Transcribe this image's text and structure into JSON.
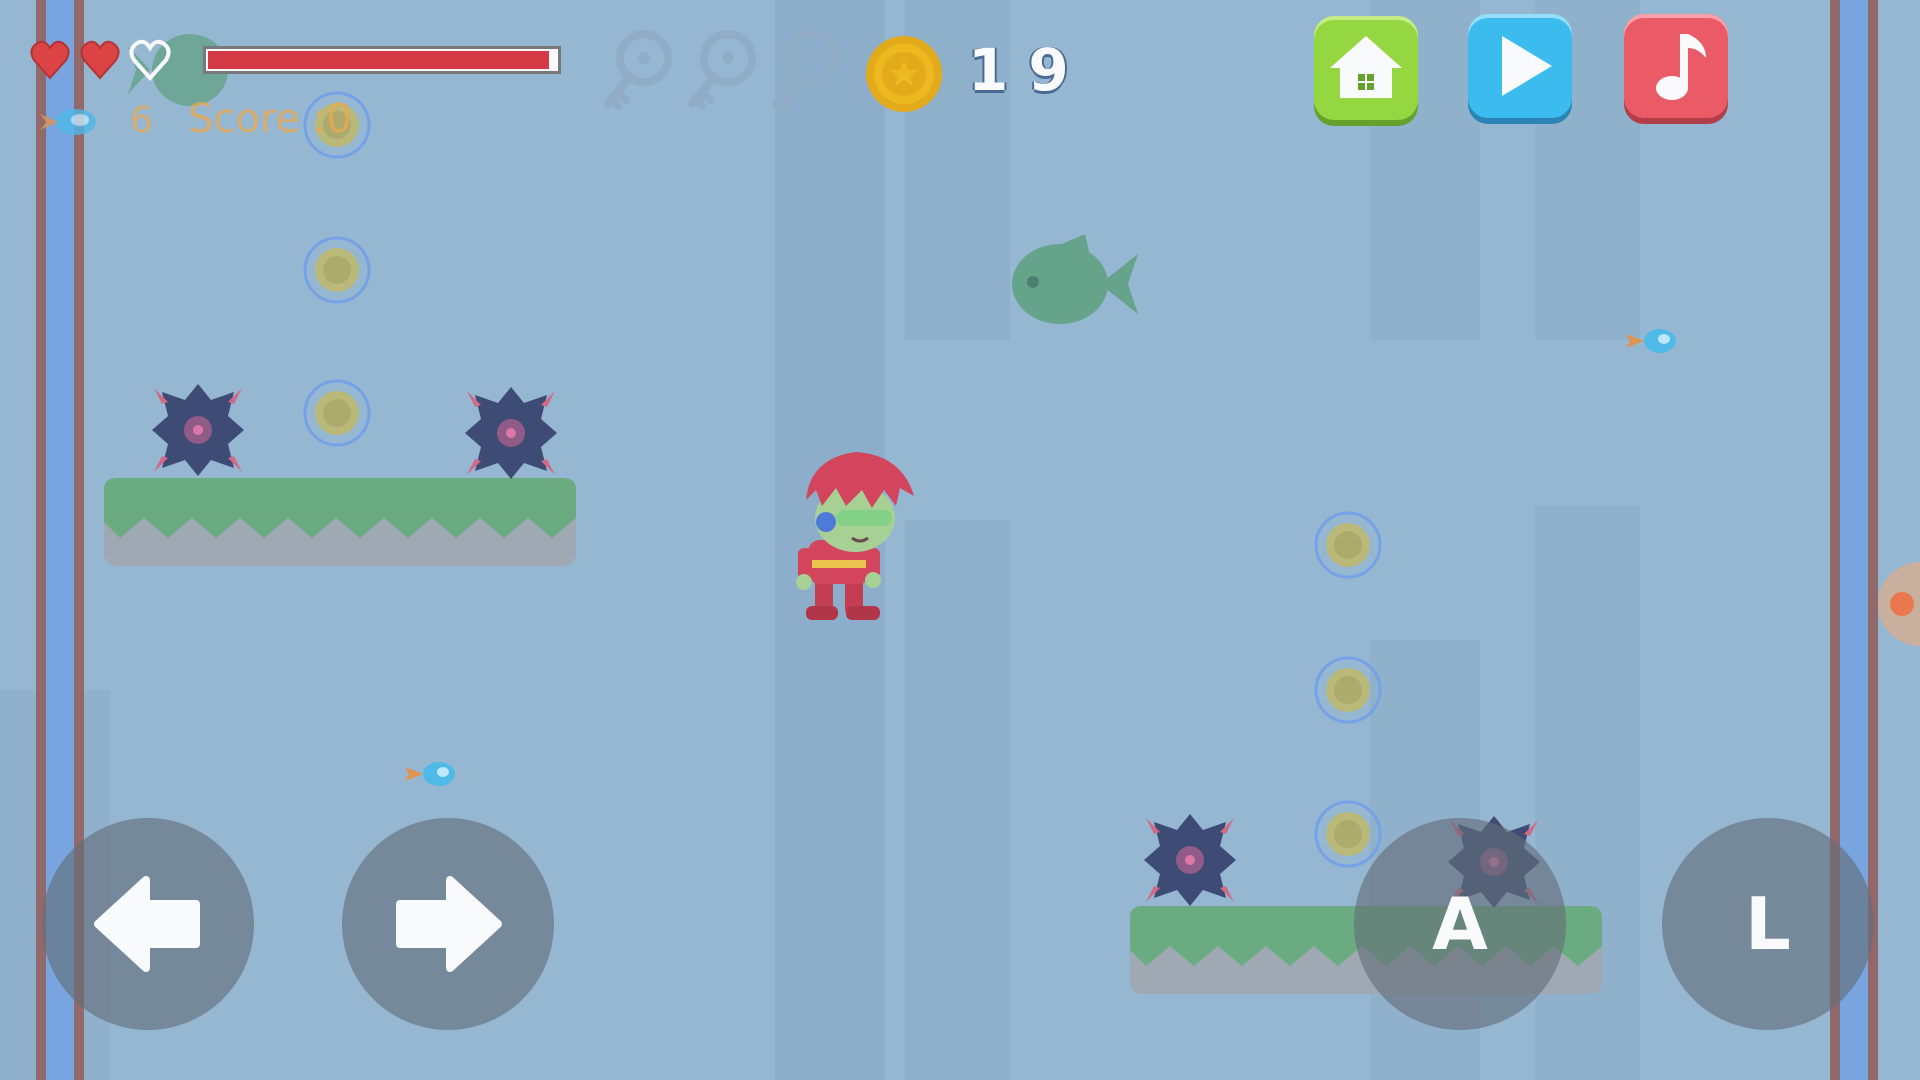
{
  "hud": {
    "hearts": [
      "full",
      "full",
      "empty"
    ],
    "health_fraction": 0.98,
    "keys_collected": 0,
    "keys_total": 3,
    "coin_count": "19",
    "ammo_count": "6",
    "score_label": "Score :",
    "score_value": "0"
  },
  "menu": {
    "home_icon": "home-icon",
    "play_icon": "play-icon",
    "music_icon": "music-note-icon"
  },
  "controls": {
    "left_icon": "arrow-left-icon",
    "right_icon": "arrow-right-icon",
    "attack_label": "A",
    "l_label": "L"
  },
  "colors": {
    "sky": "#8fb3cf",
    "pillar": "#84a7c4",
    "grass": "#5fa574",
    "stone": "#9aa3ad",
    "health_bar": "#d8262e",
    "heart": "#e02f2f",
    "coin_gold": "#f2b705",
    "home_button": "#8fd82a",
    "play_button": "#2ab8f0",
    "music_button": "#ef4b56",
    "score_orange": "#f5a33a"
  }
}
